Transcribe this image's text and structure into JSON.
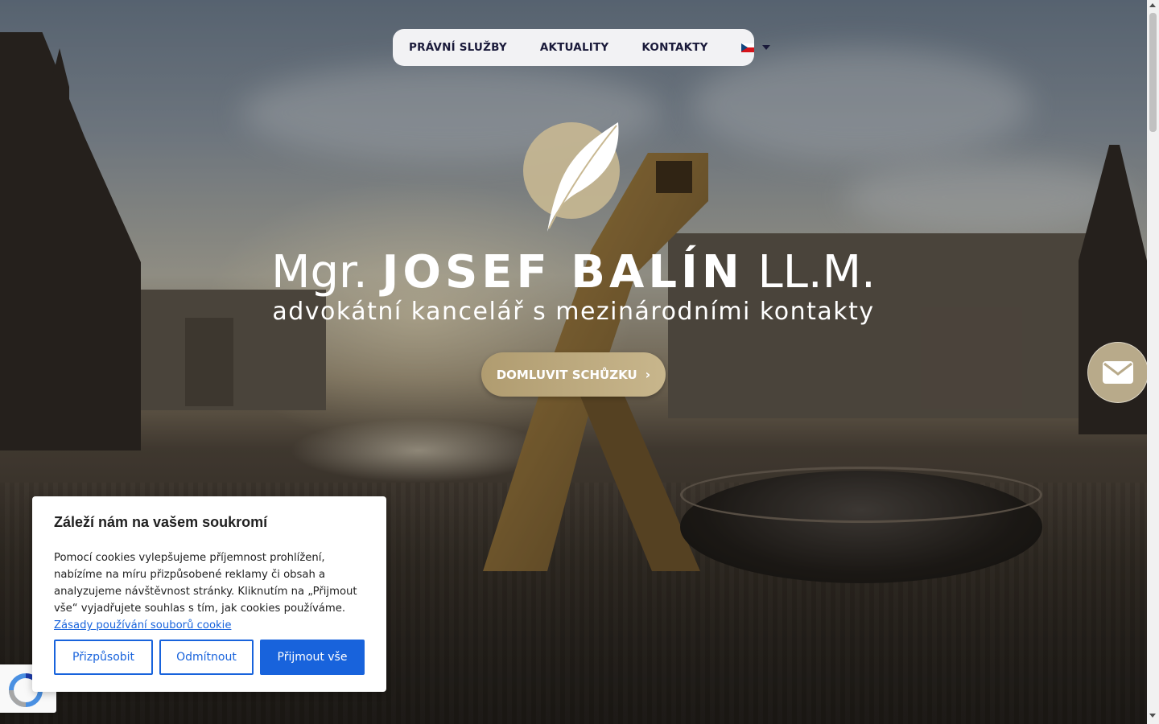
{
  "nav": {
    "items": [
      {
        "label": "PRÁVNÍ SLUŽBY"
      },
      {
        "label": "AKTUALITY"
      },
      {
        "label": "KONTAKTY"
      }
    ],
    "language_icon": "czech-flag-icon"
  },
  "hero": {
    "title_prefix": "Mgr.",
    "title_name": "JOSEF BALÍN",
    "title_suffix": "LL.M.",
    "subtitle": "advokátní kancelář s mezinárodními kontakty",
    "cta_label": "DOMLUVIT SCHŮZKU",
    "cta_icon": "chevron-right-icon",
    "mail_icon": "envelope-icon"
  },
  "cookie": {
    "title": "Záleží nám na vašem soukromí",
    "text": "Pomocí cookies vylepšujeme příjemnost prohlížení, nabízíme na míru přizpůsobené reklamy či obsah a analyzujeme návštěvnost stránky. Kliknutím na „Přijmout vše“ vyjadřujete souhlas s tím, jak cookies používáme.",
    "link": "Zásady používání souborů cookie",
    "buttons": {
      "customize": "Přizpůsobit",
      "reject": "Odmítnout",
      "accept": "Přijmout vše"
    }
  },
  "colors": {
    "accent_gold": "#b8a67c",
    "cookie_blue": "#1863dc",
    "nav_text": "#1a1a3a"
  }
}
